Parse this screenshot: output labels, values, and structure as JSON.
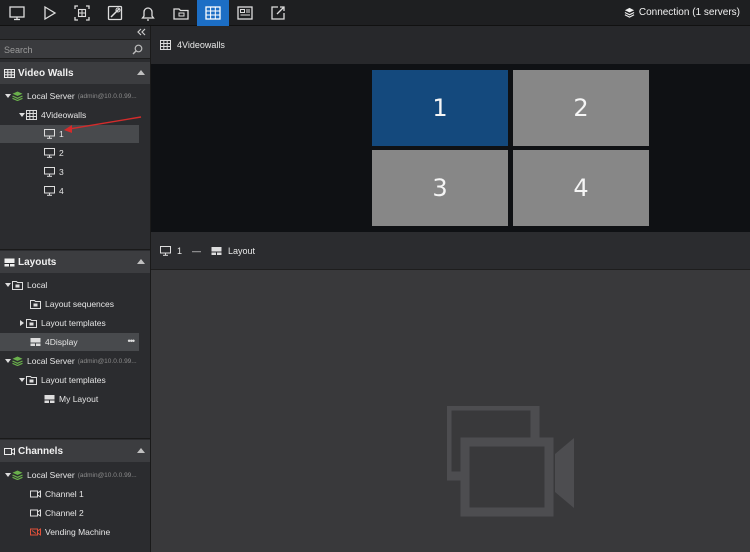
{
  "toolbar": {
    "buttons": [
      {
        "name": "monitor-icon"
      },
      {
        "name": "play-icon"
      },
      {
        "name": "scan-icon"
      },
      {
        "name": "tools-icon"
      },
      {
        "name": "bell-icon"
      },
      {
        "name": "folder-icon"
      },
      {
        "name": "videowall-grid-icon",
        "active": true
      },
      {
        "name": "screen-icon"
      },
      {
        "name": "export-icon"
      }
    ],
    "connection": "Connection (1 servers)"
  },
  "sidebar": {
    "search_placeholder": "Search",
    "videowalls": {
      "title": "Video Walls",
      "server": "Local Server",
      "server_sub": "(admin@10.0.0.99...",
      "wall": "4Videowalls",
      "monitors": [
        "1",
        "2",
        "3",
        "4"
      ]
    },
    "layouts": {
      "title": "Layouts",
      "local": "Local",
      "layout_sequences": "Layout sequences",
      "layout_templates": "Layout templates",
      "display": "4Display",
      "display_menu": "•••",
      "server": "Local Server",
      "server_sub": "(admin@10.0.0.99...",
      "server_templates": "Layout templates",
      "my_layout": "My Layout"
    },
    "channels": {
      "title": "Channels",
      "server": "Local Server",
      "server_sub": "(admin@10.0.0.99...",
      "items": [
        "Channel 1",
        "Channel 2",
        "Vending Machine"
      ]
    }
  },
  "main": {
    "wall_title": "4Videowalls",
    "tiles": [
      "1",
      "2",
      "3",
      "4"
    ],
    "selected_tile": "1",
    "info_monitor": "1",
    "info_separator": "—",
    "info_layout": "Layout"
  },
  "colors": {
    "accent": "#1c6ec5",
    "selected_tile": "#14497d",
    "tile": "#878787",
    "server_icon": "#6ab04c",
    "alert_channel": "#e0513a",
    "annotation": "#d42b2b"
  }
}
